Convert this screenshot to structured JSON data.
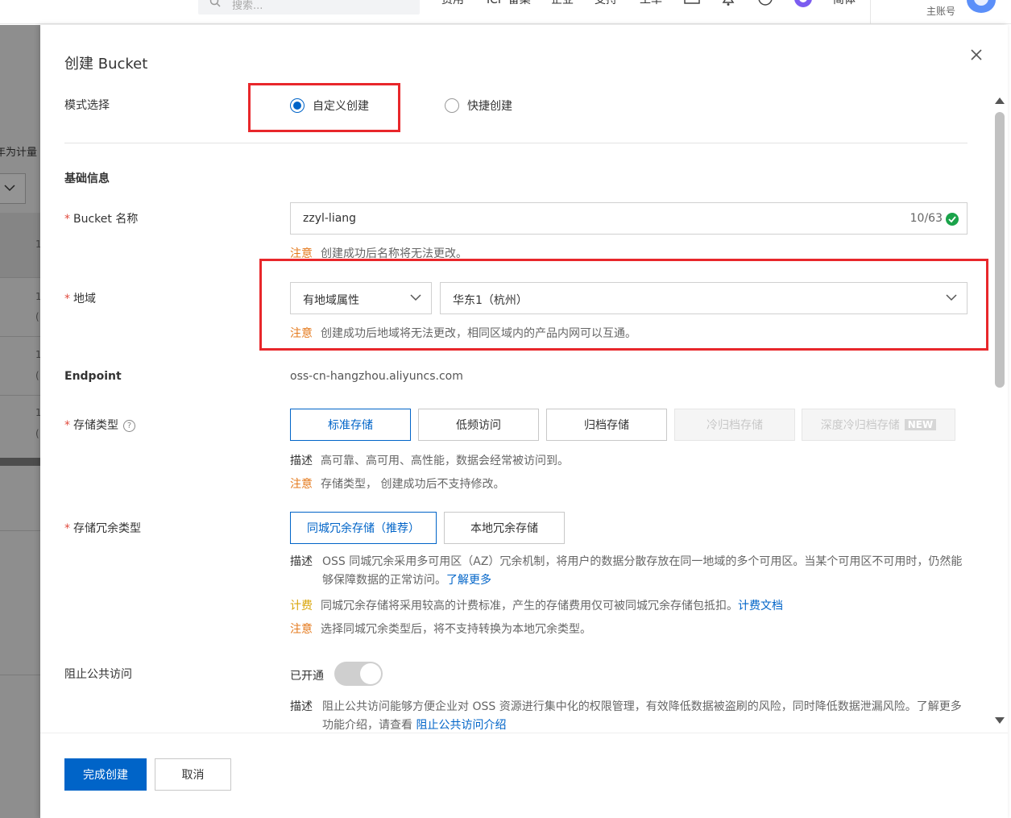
{
  "topbar": {
    "search_placeholder": "搜索...",
    "nav": [
      "费用",
      "ICP 备案",
      "企业",
      "支持",
      "工单"
    ],
    "lang": "简体",
    "account": "主账号"
  },
  "background": {
    "tab_label": "年为计量",
    "fragments": [
      "1",
      "1",
      "(",
      "1",
      "(",
      "1",
      "("
    ]
  },
  "dialog": {
    "title": "创建 Bucket",
    "mode": {
      "label": "模式选择",
      "options": [
        "自定义创建",
        "快捷创建"
      ],
      "selected": "自定义创建"
    },
    "basic_section": "基础信息",
    "bucket_name": {
      "label": "Bucket 名称",
      "value": "zzyl-liang",
      "counter": "10/63",
      "note_tag": "注意",
      "note": "创建成功后名称将无法更改。"
    },
    "region": {
      "label": "地域",
      "attr_select": "有地域属性",
      "region_select": "华东1（杭州）",
      "note_tag": "注意",
      "note": "创建成功后地域将无法更改，相同区域内的产品内网可以互通。"
    },
    "endpoint": {
      "label": "Endpoint",
      "value": "oss-cn-hangzhou.aliyuncs.com"
    },
    "storage_type": {
      "label": "存储类型",
      "help": "?",
      "options": [
        "标准存储",
        "低频访问",
        "归档存储",
        "冷归档存储",
        "深度冷归档存储"
      ],
      "new_badge": "NEW",
      "desc_tag": "描述",
      "desc": "高可靠、高可用、高性能，数据会经常被访问到。",
      "note_tag": "注意",
      "note": "存储类型， 创建成功后不支持修改。"
    },
    "redundancy": {
      "label": "存储冗余类型",
      "options": [
        "同城冗余存储（推荐）",
        "本地冗余存储"
      ],
      "desc_tag": "描述",
      "desc": "OSS 同城冗余采用多可用区（AZ）冗余机制，将用户的数据分散存放在同一地域的多个可用区。当某个可用区不可用时，仍然能够保障数据的正常访问。",
      "desc_link": "了解更多",
      "fee_tag": "计费",
      "fee": "同城冗余存储将采用较高的计费标准，产生的存储费用仅可被同城冗余存储包抵扣。",
      "fee_link": "计费文档",
      "note_tag": "注意",
      "note": "选择同城冗余类型后，将不支持转换为本地冗余类型。"
    },
    "public_access": {
      "label": "阻止公共访问",
      "status": "已开通",
      "enabled": true,
      "desc_tag": "描述",
      "desc": "阻止公共访问能够方便企业对 OSS 资源进行集中化的权限管理，有效降低数据被盗刷的风险，同时降低数据泄漏风险。了解更多功能介绍，请查看 ",
      "desc_link": "阻止公共访问介绍"
    },
    "footer": {
      "submit": "完成创建",
      "cancel": "取消"
    }
  },
  "colors": {
    "primary": "#0064c8",
    "warning": "#e4791c",
    "fee": "#d9a60b",
    "required": "#e14c3f",
    "highlight": "#e8272b"
  }
}
